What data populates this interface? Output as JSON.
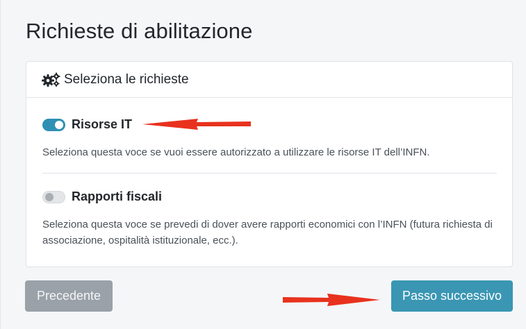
{
  "page": {
    "title": "Richieste di abilitazione"
  },
  "card": {
    "header_icon": "cogs-icon",
    "header_title": "Seleziona le richieste"
  },
  "options": [
    {
      "label": "Risorse IT",
      "enabled": true,
      "description": "Seleziona questa voce se vuoi essere autorizzato a utilizzare le risorse IT dell’INFN."
    },
    {
      "label": "Rapporti fiscali",
      "enabled": false,
      "description": "Seleziona questa voce se prevedi di dover avere rapporti economici con l’INFN (futura richiesta di associazione, ospitalità istituzionale, ecc.)."
    }
  ],
  "buttons": {
    "previous_label": "Precedente",
    "next_label": "Passo successivo"
  },
  "colors": {
    "accent": "#3a96b3",
    "switch_on": "#2f8fb4",
    "annotation_arrow": "#e8321e",
    "disabled_button": "#9aa1a8"
  }
}
